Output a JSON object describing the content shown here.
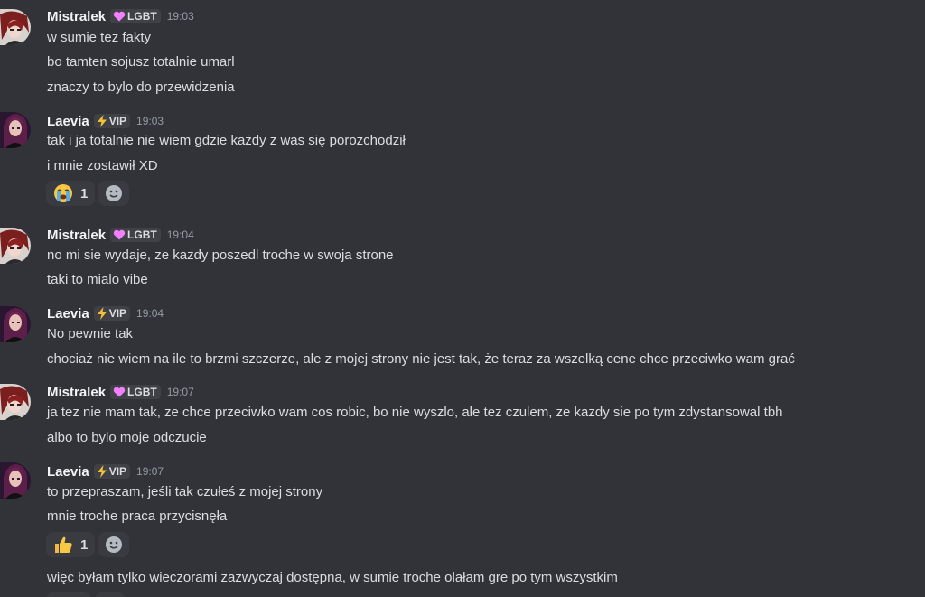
{
  "colors": {
    "background": "#323339",
    "username": "#f2f3f5",
    "text": "#dbdee1",
    "timestamp": "#949ba4",
    "tag_background": "#3f4147",
    "reaction_background": "#393b41"
  },
  "messages": [
    {
      "author": "Mistralek",
      "tag": {
        "icon": "pink-heart-icon",
        "label": "LGBT"
      },
      "time": "19:03",
      "lines": [
        "w sumie tez fakty",
        "bo tamten sojusz totalnie umarl",
        "znaczy to bylo do przewidzenia"
      ]
    },
    {
      "author": "Laevia",
      "tag": {
        "icon": "lightning-icon",
        "label": "VIP"
      },
      "time": "19:03",
      "lines": [
        "tak i ja totalnie nie wiem gdzie każdy z was się porozchodził",
        "i mnie zostawił XD"
      ],
      "reaction": {
        "emoji": "loudly-crying-face-icon",
        "count": "1"
      }
    },
    {
      "author": "Mistralek",
      "tag": {
        "icon": "pink-heart-icon",
        "label": "LGBT"
      },
      "time": "19:04",
      "lines": [
        "no mi sie wydaje, ze kazdy poszedl troche w swoja strone",
        "taki to mialo vibe"
      ]
    },
    {
      "author": "Laevia",
      "tag": {
        "icon": "lightning-icon",
        "label": "VIP"
      },
      "time": "19:04",
      "lines": [
        "No pewnie tak",
        "chociaż nie wiem na ile to brzmi szczerze, ale z mojej strony nie jest tak, że teraz za wszelką cene chce przeciwko wam grać"
      ]
    },
    {
      "author": "Mistralek",
      "tag": {
        "icon": "pink-heart-icon",
        "label": "LGBT"
      },
      "time": "19:07",
      "lines": [
        "ja tez nie mam tak, ze chce przeciwko wam cos robic, bo nie wyszlo, ale tez czulem, ze kazdy sie po tym zdystansowal tbh",
        "albo to bylo moje odczucie"
      ]
    },
    {
      "author": "Laevia",
      "tag": {
        "icon": "lightning-icon",
        "label": "VIP"
      },
      "time": "19:07",
      "lines": [
        "to przepraszam, jeśli tak czułeś z mojej strony",
        "mnie troche praca przycisnęła"
      ],
      "reaction": {
        "emoji": "thumbs-up-icon",
        "count": "1"
      },
      "after": [
        "więc byłam tylko wieczorami zazwyczaj dostępna, w sumie troche olałam gre po tym wszystkim"
      ]
    }
  ]
}
